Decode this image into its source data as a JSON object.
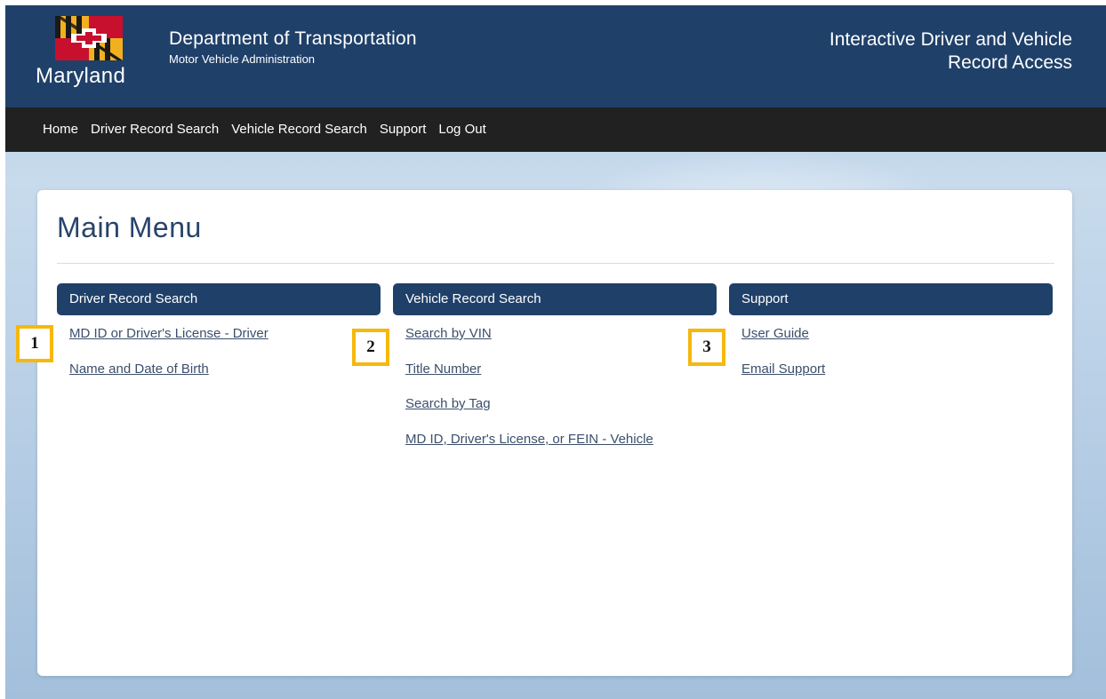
{
  "header": {
    "logo_text": "Maryland",
    "dept_title": "Department of Transportation",
    "dept_subtitle": "Motor Vehicle Administration",
    "app_title_line1": "Interactive Driver and Vehicle",
    "app_title_line2": "Record Access",
    "brand_color": "#1f4069"
  },
  "nav": {
    "items": [
      "Home",
      "Driver Record Search",
      "Vehicle Record Search",
      "Support",
      "Log Out"
    ]
  },
  "main": {
    "title": "Main Menu",
    "columns": [
      {
        "heading": "Driver Record Search",
        "links": [
          "MD ID or Driver's License - Driver",
          "Name and Date of Birth"
        ]
      },
      {
        "heading": "Vehicle Record Search",
        "links": [
          "Search by VIN",
          "Title Number",
          "Search by Tag",
          "MD ID, Driver's License, or FEIN - Vehicle"
        ]
      },
      {
        "heading": "Support",
        "links": [
          "User Guide",
          "Email Support"
        ]
      }
    ]
  },
  "callouts": [
    "1",
    "2",
    "3"
  ],
  "colors": {
    "header_bg": "#1f4069",
    "navbar_bg": "#212121",
    "callout_border": "#f5b80c"
  }
}
